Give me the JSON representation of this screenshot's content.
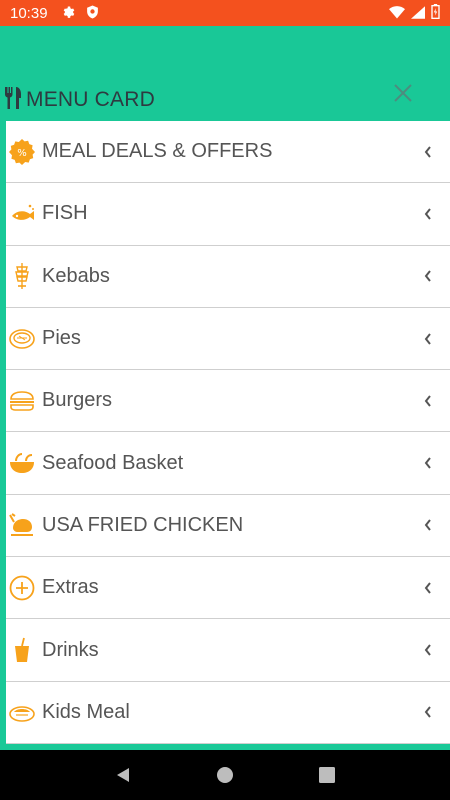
{
  "status_bar": {
    "time": "10:39",
    "left_icons": [
      "gear-icon",
      "shield-icon"
    ],
    "right_icons": [
      "wifi-icon",
      "signal-icon",
      "battery-icon"
    ]
  },
  "header": {
    "title": "MENU CARD",
    "title_icon": "utensils-icon",
    "close_icon": "close-icon"
  },
  "menu": {
    "items": [
      {
        "label": "MEAL DEALS & OFFERS",
        "icon": "percent-badge-icon"
      },
      {
        "label": "FISH",
        "icon": "fish-icon"
      },
      {
        "label": "Kebabs",
        "icon": "kebab-icon"
      },
      {
        "label": "Pies",
        "icon": "pie-icon"
      },
      {
        "label": "Burgers",
        "icon": "burger-icon"
      },
      {
        "label": "Seafood Basket",
        "icon": "bowl-icon"
      },
      {
        "label": "USA FRIED CHICKEN",
        "icon": "chicken-icon"
      },
      {
        "label": "Extras",
        "icon": "plus-circle-icon"
      },
      {
        "label": "Drinks",
        "icon": "drink-icon"
      },
      {
        "label": "Kids Meal",
        "icon": "kids-meal-icon"
      }
    ]
  },
  "nav": {
    "buttons": [
      "back-icon",
      "home-icon",
      "recents-icon"
    ]
  },
  "colors": {
    "accent": "#19c897",
    "status_bar": "#f4511e",
    "icon_orange": "#f7a21b"
  }
}
